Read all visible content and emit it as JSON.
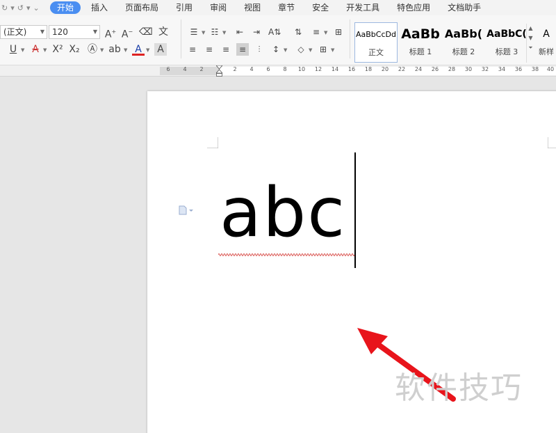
{
  "menubar": {
    "tabs": [
      {
        "label": "开始",
        "active": true
      },
      {
        "label": "插入"
      },
      {
        "label": "页面布局"
      },
      {
        "label": "引用"
      },
      {
        "label": "审阅"
      },
      {
        "label": "视图"
      },
      {
        "label": "章节"
      },
      {
        "label": "安全"
      },
      {
        "label": "开发工具"
      },
      {
        "label": "特色应用"
      },
      {
        "label": "文档助手"
      }
    ]
  },
  "ribbon": {
    "font_name": "(正文)",
    "font_size": "120",
    "styles": [
      {
        "sample": "AaBbCcDd",
        "label": "正文"
      },
      {
        "sample": "AaBb",
        "label": "标题 1"
      },
      {
        "sample": "AaBb(",
        "label": "标题 2"
      },
      {
        "sample": "AaBbC(",
        "label": "标题 3"
      },
      {
        "sample": "A",
        "label": "新样"
      }
    ]
  },
  "ruler": {
    "ticks": [
      "6",
      "4",
      "2",
      "2",
      "4",
      "6",
      "8",
      "10",
      "12",
      "14",
      "16",
      "18",
      "20",
      "22",
      "24",
      "26",
      "28",
      "30",
      "32",
      "34",
      "36",
      "38",
      "40"
    ]
  },
  "document": {
    "text": "abc"
  },
  "watermark": "软件技巧",
  "colors": {
    "accent": "#4a8ef1",
    "arrow": "#e8141b",
    "spellcheck": "#d9534f"
  }
}
